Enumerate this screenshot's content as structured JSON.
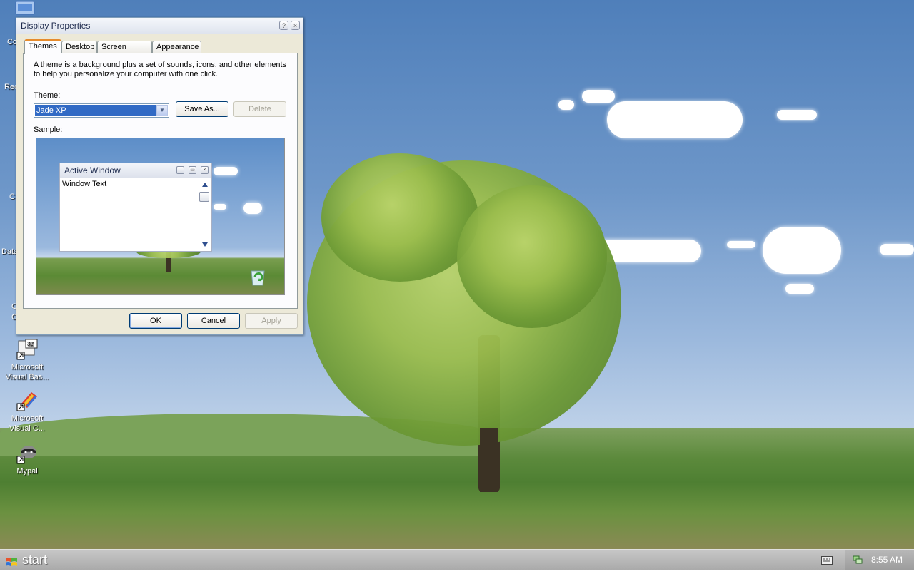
{
  "desktop": {
    "icons": [
      {
        "label_line1": "Microsoft",
        "label_line2": "Visual Bas..."
      },
      {
        "label_line1": "Microsoft",
        "label_line2": "Visual C..."
      },
      {
        "label_line1": "Mypal",
        "label_line2": ""
      }
    ],
    "partial_labels": [
      "Co",
      "Rec",
      "C",
      "Data",
      "C",
      "C"
    ]
  },
  "dialog": {
    "title": "Display Properties",
    "help_button": "?",
    "close_button": "×",
    "tabs": [
      "Themes",
      "Desktop",
      "Screen Saver",
      "Appearance"
    ],
    "active_tab": "Themes",
    "description": "A theme is a background plus a set of sounds, icons, and other elements to help you personalize your computer with one click.",
    "theme_label": "Theme:",
    "theme_value": "Jade XP",
    "save_as_label": "Save As...",
    "delete_label": "Delete",
    "sample_label": "Sample:",
    "sample_window": {
      "title": "Active Window",
      "text": "Window Text"
    },
    "ok_label": "OK",
    "cancel_label": "Cancel",
    "apply_label": "Apply"
  },
  "taskbar": {
    "start_label": "start",
    "clock": "8:55 AM"
  },
  "colors": {
    "selection": "#316ac5",
    "active_tab_accent": "#e68b2c",
    "button_border": "#003c74"
  }
}
